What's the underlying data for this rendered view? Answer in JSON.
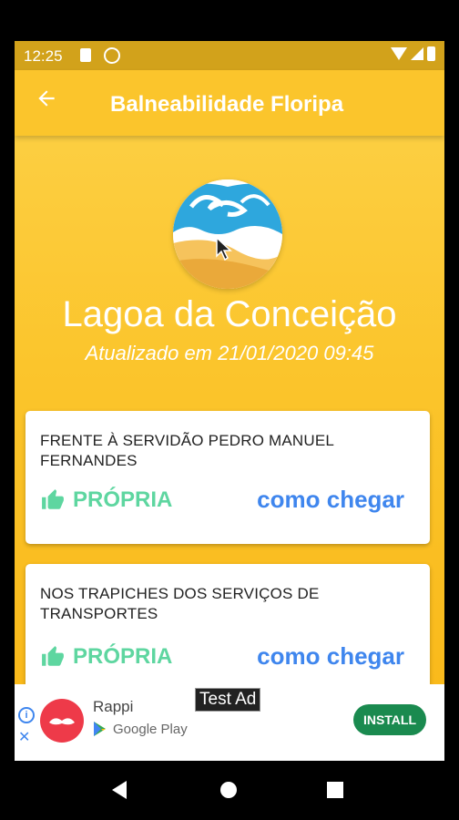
{
  "status_bar": {
    "time": "12:25"
  },
  "app_bar": {
    "title": "Balneabilidade Floripa",
    "back_icon": "arrow-back-icon"
  },
  "beach": {
    "name": "Lagoa da Conceição",
    "updated": "Atualizado em 21/01/2020 09:45"
  },
  "colors": {
    "background": "#fbc52c",
    "status_good": "#5ed6a0",
    "link": "#3f86ee"
  },
  "points": [
    {
      "location": "FRENTE À SERVIDÃO PEDRO MANUEL FERNANDES",
      "status": "PRÓPRIA",
      "link": "como chegar"
    },
    {
      "location": "NOS TRAPICHES DOS SERVIÇOS DE TRANSPORTES",
      "status": "PRÓPRIA",
      "link": "como chegar"
    }
  ],
  "ad": {
    "app_name": "Rappi",
    "store": "Google Play",
    "install": "INSTALL",
    "label": "Test Ad"
  }
}
